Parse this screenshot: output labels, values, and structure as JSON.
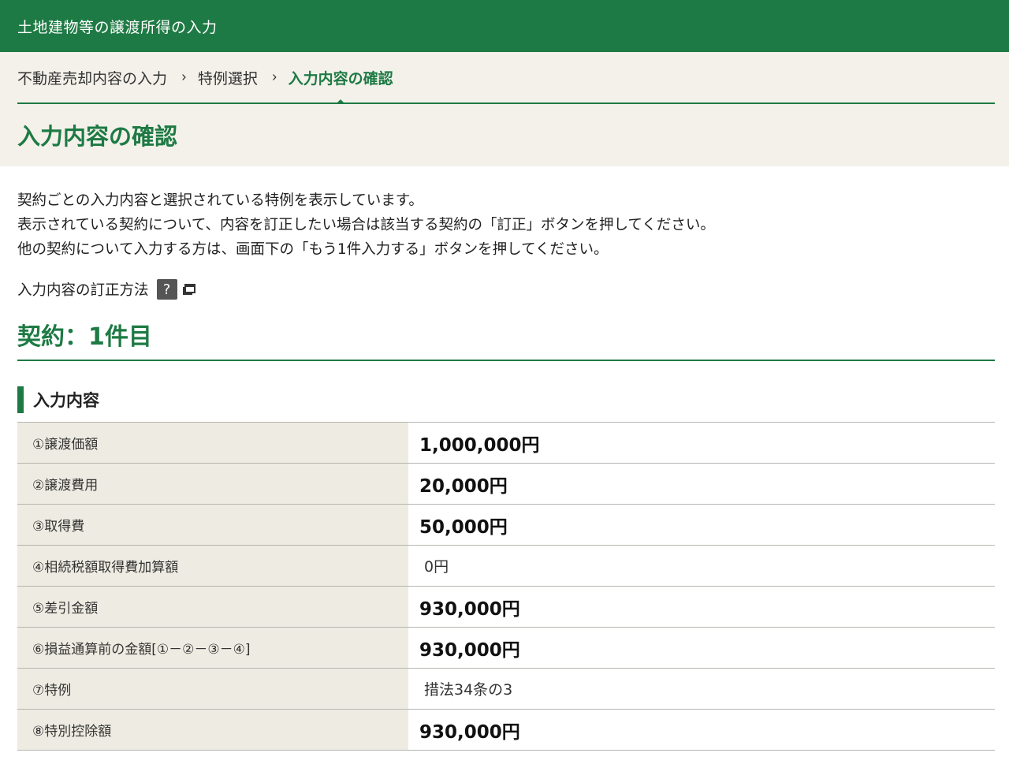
{
  "header": {
    "app_title": "土地建物等の譲渡所得の入力"
  },
  "breadcrumb": {
    "steps": [
      "不動産売却内容の入力",
      "特例選択",
      "入力内容の確認"
    ],
    "separator": "›"
  },
  "page": {
    "title": "入力内容の確認",
    "intro": [
      "契約ごとの入力内容と選択されている特例を表示しています。",
      "表示されている契約について、内容を訂正したい場合は該当する契約の「訂正」ボタンを押してください。",
      "他の契約について入力する方は、画面下の「もう1件入力する」ボタンを押してください。"
    ],
    "howto_label": "入力内容の訂正方法",
    "help_icon_text": "?"
  },
  "contract": {
    "heading": "契約：1件目",
    "section_title": "入力内容",
    "rows": [
      {
        "label": "①譲渡価額",
        "value": "1,000,000円",
        "emphasis": true
      },
      {
        "label": "②譲渡費用",
        "value": "20,000円",
        "emphasis": true
      },
      {
        "label": "③取得費",
        "value": "50,000円",
        "emphasis": true
      },
      {
        "label": "④相続税額取得費加算額",
        "value": "0円",
        "emphasis": false
      },
      {
        "label": "⑤差引金額",
        "value": "930,000円",
        "emphasis": true
      },
      {
        "label": "⑥損益通算前の金額[①－②－③－④]",
        "value": "930,000円",
        "emphasis": true
      },
      {
        "label": "⑦特例",
        "value": "措法34条の3",
        "emphasis": false
      },
      {
        "label": "⑧特別控除額",
        "value": "930,000円",
        "emphasis": true
      }
    ]
  },
  "colors": {
    "brand_green": "#1e7a44",
    "header_bg": "#f3f1ea",
    "label_bg": "#eeece2"
  }
}
